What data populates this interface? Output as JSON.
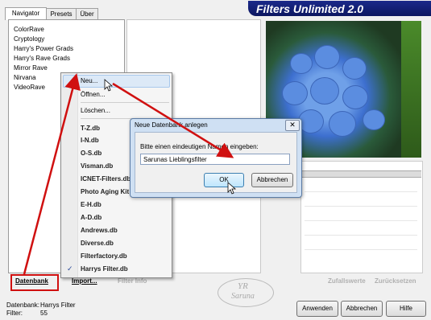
{
  "tabs": [
    "Navigator",
    "Presets",
    "Über"
  ],
  "app_title": "Filters Unlimited 2.0",
  "filter_list": [
    "ColorRave",
    "Cryptology",
    "Harry's Power Grads",
    "Harry's Rave Grads",
    "Mirror Rave",
    "Nirvana",
    "VideoRave"
  ],
  "context_menu": {
    "new": "Neu...",
    "open": "Öffnen...",
    "delete": "Löschen...",
    "databases": [
      "T-Z.db",
      "I-N.db",
      "O-S.db",
      "Visman.db",
      "ICNET-Filters.db",
      "Photo Aging Kit",
      "E-H.db",
      "A-D.db",
      "Andrews.db",
      "Diverse.db",
      "Filterfactory.db",
      "Harrys Filter.db"
    ],
    "checked": "Harrys Filter.db",
    "check_mark": "✓"
  },
  "dialog": {
    "title": "Neue Datenbank anlegen",
    "prompt": "Bitte einen eindeutigen Namen eingeben:",
    "input_value": "Sarunas Lieblingsfilter",
    "ok": "OK",
    "cancel": "Abbrechen",
    "close_glyph": "✕"
  },
  "bottom_links": {
    "datenbank": "Datenbank",
    "import": "Import...",
    "filter_info": "Filter Info",
    "zufallswerte": "Zufallswerte",
    "zuruecksetzen": "Zurücksetzen"
  },
  "buttons": {
    "apply": "Anwenden",
    "cancel": "Abbrechen",
    "help": "Hilfe"
  },
  "watermark": {
    "line1": "YR",
    "line2": "Saruna"
  },
  "status": {
    "db_label": "Datenbank:",
    "db_value": "Harrys Filter",
    "filter_label": "Filter:",
    "filter_value": "55"
  },
  "colors": {
    "accent_red": "#d01010",
    "banner": "#1b2a8a",
    "selection": "#dce9f7"
  }
}
